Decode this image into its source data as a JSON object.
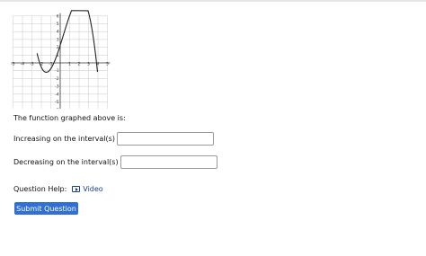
{
  "question": {
    "prompt": "The function graphed above is:",
    "increasing_label": "Increasing on the interval(s)",
    "decreasing_label": "Decreasing on the interval(s)",
    "increasing_value": "",
    "decreasing_value": ""
  },
  "help": {
    "label": "Question Help:",
    "video_label": "Video",
    "video_icon": "play-icon"
  },
  "submit_label": "Submit Question",
  "graph": {
    "x_ticks": [
      "-5",
      "-4",
      "-3",
      "-2",
      "-1",
      "1",
      "2",
      "3",
      "4",
      "5"
    ],
    "y_ticks": [
      "6",
      "5",
      "4",
      "3",
      "2",
      "1",
      "-1",
      "-2",
      "-3",
      "-4",
      "-5",
      "-6"
    ],
    "x_range": [
      -5,
      5
    ],
    "y_range": [
      -6,
      6
    ],
    "grid": true
  },
  "colors": {
    "button": "#2f6fd6",
    "link": "#1a3e8c"
  }
}
